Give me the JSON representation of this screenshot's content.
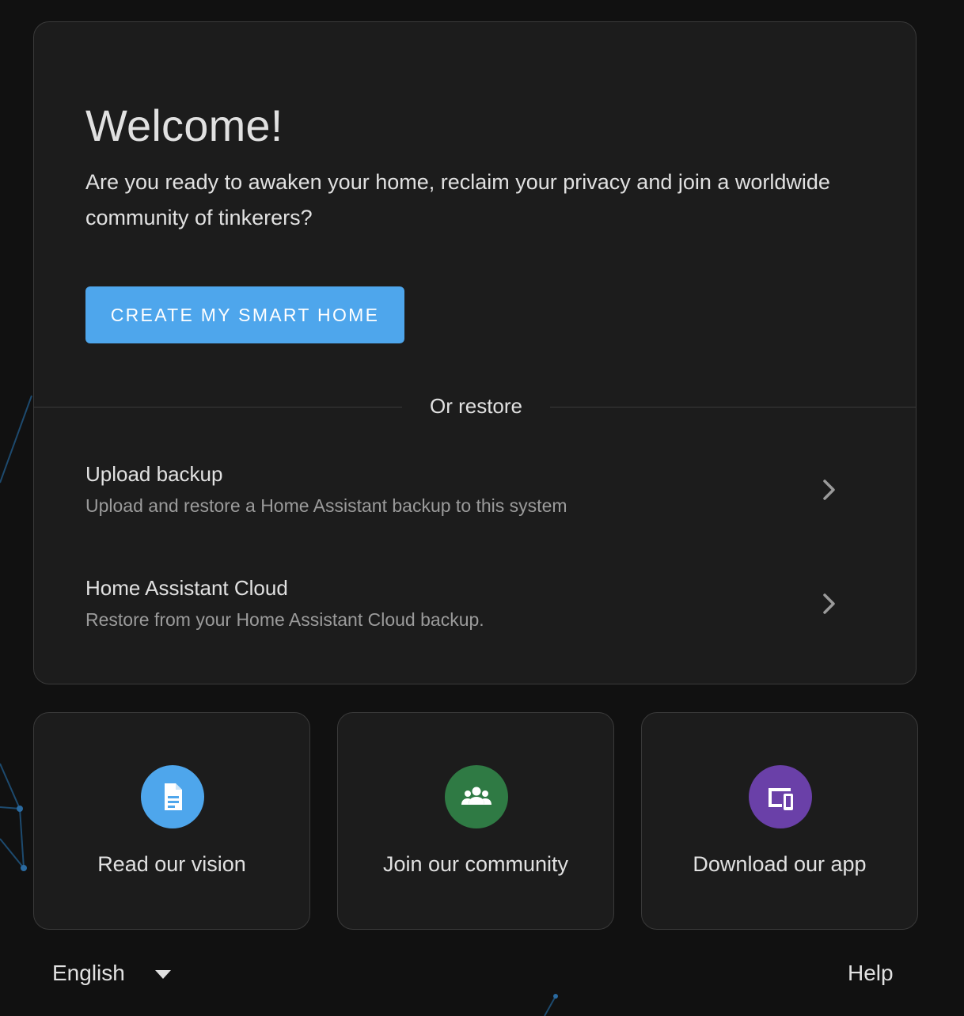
{
  "welcome": {
    "title": "Welcome!",
    "text": "Are you ready to awaken your home, reclaim your privacy and join a worldwide community of tinkerers?",
    "create_button_label": "CREATE MY SMART HOME"
  },
  "restore": {
    "divider_label": "Or restore",
    "items": [
      {
        "title": "Upload backup",
        "description": "Upload and restore a Home Assistant backup to this system",
        "icon": "chevron-right-icon"
      },
      {
        "title": "Home Assistant Cloud",
        "description": "Restore from your Home Assistant Cloud backup.",
        "icon": "chevron-right-icon"
      }
    ]
  },
  "links": [
    {
      "label": "Read our vision",
      "icon": "document-icon",
      "color": "#4ea6ec"
    },
    {
      "label": "Join our community",
      "icon": "people-icon",
      "color": "#2f7a44"
    },
    {
      "label": "Download our app",
      "icon": "devices-icon",
      "color": "#6a40a8"
    }
  ],
  "footer": {
    "language": "English",
    "help": "Help"
  },
  "colors": {
    "background": "#111111",
    "card": "#1c1c1c",
    "border": "#3a3a3a",
    "accent": "#4ea6ec",
    "text": "#e1e1e1",
    "secondary_text": "#9b9b9b"
  }
}
